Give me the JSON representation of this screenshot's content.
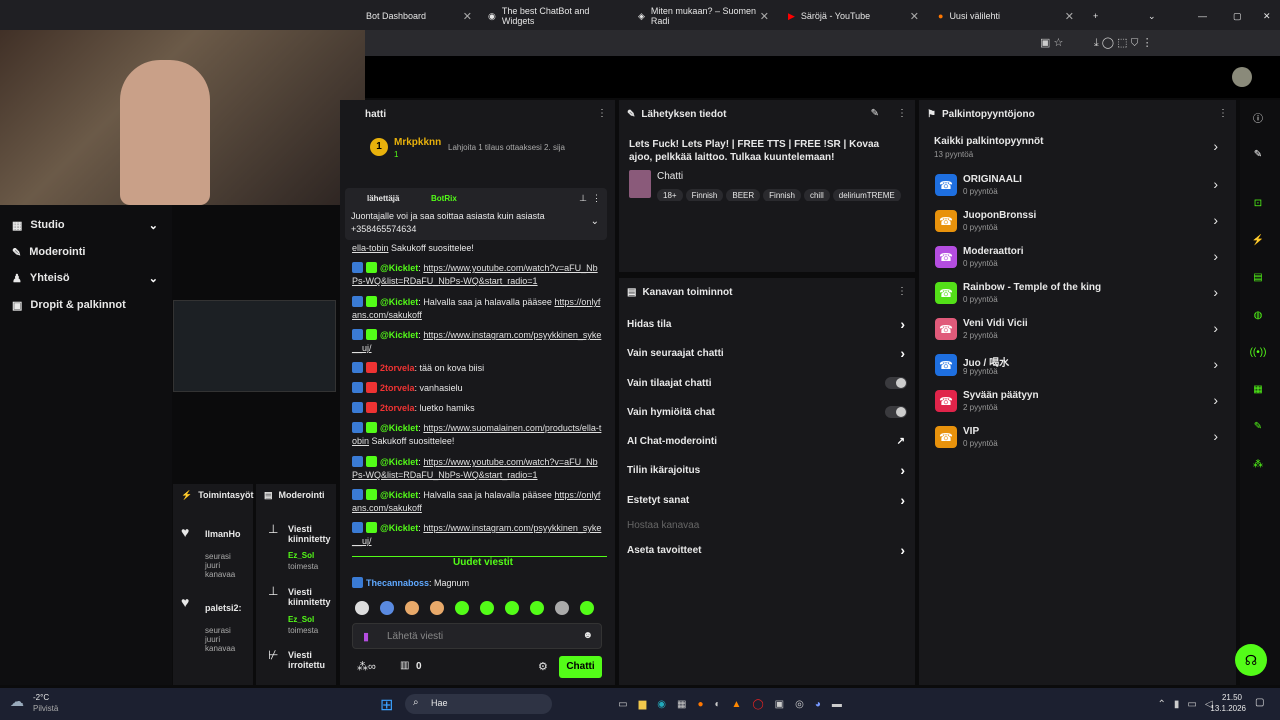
{
  "tabs": [
    {
      "label": "Bot Dashboard"
    },
    {
      "label": "The best ChatBot and Widgets"
    },
    {
      "label": "Miten mukaan? – Suomen Radi"
    },
    {
      "label": "Säröjä - YouTube"
    },
    {
      "label": "Uusi välilehti"
    }
  ],
  "sidebar": {
    "items": [
      {
        "label": "Studio"
      },
      {
        "label": "Moderointi"
      },
      {
        "label": "Yhteisö"
      },
      {
        "label": "Dropit & palkinnot"
      }
    ]
  },
  "chat": {
    "title": "hatti",
    "top_user": "Mrkpkknn",
    "top_badge": "1",
    "gift_text": "Lahjoita 1 tilaus ottaaksesi 2. sija",
    "pinned_by": "lähettäjä",
    "pinned_user": "BotRix",
    "pinned_text": "Juontajalle voi ja saa soittaa asiasta kuin asiasta +358465574634",
    "messages": [
      {
        "user": "",
        "text": "ella-tobin",
        "link": "",
        "tail": " Sakukoff suosittelee!",
        "color": "#53fc18"
      },
      {
        "user": "@Kicklet",
        "link": "https://www.youtube.com/watch?v=aFU_NbPs-WQ&list=RDaFU_NbPs-WQ&start_radio=1",
        "text": "",
        "tail": "",
        "color": "#53fc18"
      },
      {
        "user": "@Kicklet",
        "text": "Halvalla saa ja halavalla pääsee ",
        "link": "https://onlyfans.com/sakukoff",
        "tail": "",
        "color": "#53fc18"
      },
      {
        "user": "@Kicklet",
        "link": "https://www.instagram.com/psyykkinen_syke__uj/",
        "text": "",
        "tail": "",
        "color": "#53fc18"
      },
      {
        "user": "2torvela",
        "text": "tää on kova biisi",
        "link": "",
        "tail": "",
        "color": "#e33"
      },
      {
        "user": "2torvela",
        "text": "vanhasielu",
        "link": "",
        "tail": "",
        "color": "#e33"
      },
      {
        "user": "2torvela",
        "text": "luetko hamiks",
        "link": "",
        "tail": "",
        "color": "#e33"
      },
      {
        "user": "@Kicklet",
        "link": "https://www.suomalainen.com/products/ella-tobin",
        "text": "",
        "tail": " Sakukoff suosittelee!",
        "color": "#53fc18"
      },
      {
        "user": "@Kicklet",
        "link": "https://www.youtube.com/watch?v=aFU_NbPs-WQ&list=RDaFU_NbPs-WQ&start_radio=1",
        "text": "",
        "tail": "",
        "color": "#53fc18"
      },
      {
        "user": "@Kicklet",
        "text": "Halvalla saa ja halavalla pääsee ",
        "link": "https://onlyfans.com/sakukoff",
        "tail": "",
        "color": "#53fc18"
      },
      {
        "user": "@Kicklet",
        "link": "https://www.instagram.com/psyykkinen_syke__uj/",
        "text": "",
        "tail": "",
        "color": "#53fc18"
      }
    ],
    "new_messages": "Uudet viestit",
    "last_user": "Thecannaboss",
    "last_text": "Magnum",
    "input_placeholder": "Lähetä viesti",
    "points": "0",
    "send_label": "Chatti"
  },
  "stream_info": {
    "title": "Lähetyksen tiedot",
    "stream_title": "Lets Fuck! Lets Play! | FREE TTS | FREE !SR | Kovaa ajoo, pelkkää laittoo. Tulkaa kuuntelemaan!",
    "category": "Chatti",
    "tags": [
      "18+",
      "Finnish",
      "BEER",
      "Finnish",
      "chill",
      "deliriumTREME"
    ]
  },
  "channel_actions": {
    "title": "Kanavan toiminnot",
    "items": [
      {
        "label": "Hidas tila",
        "kind": "chev"
      },
      {
        "label": "Vain seuraajat chatti",
        "kind": "chev"
      },
      {
        "label": "Vain tilaajat chatti",
        "kind": "toggle"
      },
      {
        "label": "Vain hymiöitä chat",
        "kind": "toggle"
      },
      {
        "label": "AI Chat-moderointi",
        "kind": "ext"
      },
      {
        "label": "Tilin ikärajoitus",
        "kind": "chev"
      },
      {
        "label": "Estetyt sanat",
        "kind": "chev"
      },
      {
        "label": "Hostaa kanavaa",
        "kind": "dim"
      },
      {
        "label": "Aseta tavoitteet",
        "kind": "chev"
      }
    ]
  },
  "rewards": {
    "title": "Palkintopyyntöjono",
    "all_label": "Kaikki palkintopyynnöt",
    "all_count": "13 pyyntöä",
    "items": [
      {
        "name": "ORIGINAALI",
        "count": "0 pyyntöä",
        "color": "#1e6fe0"
      },
      {
        "name": "JuoponBronssi",
        "count": "0 pyyntöä",
        "color": "#e8920c"
      },
      {
        "name": "Moderaattori",
        "count": "0 pyyntöä",
        "color": "#b44de0"
      },
      {
        "name": "Rainbow - Temple of the king",
        "count": "0 pyyntöä",
        "color": "#53e018"
      },
      {
        "name": "Veni Vidi Vicii",
        "count": "2 pyyntöä",
        "color": "#e05a7a"
      },
      {
        "name": "Juo / 喝水",
        "count": "9 pyyntöä",
        "color": "#1e6fe0"
      },
      {
        "name": "Syvään päätyyn",
        "count": "2 pyyntöä",
        "color": "#e0244a"
      },
      {
        "name": "VIP",
        "count": "0 pyyntöä",
        "color": "#e8920c"
      }
    ]
  },
  "bottom": {
    "tab1": "Toimintasyöt",
    "tab2": "Moderointi",
    "feed": [
      {
        "name": "IlmanHo",
        "sub": "seurasi juuri kanavaa"
      },
      {
        "name": "paletsi2:",
        "sub": "seurasi juuri kanavaa"
      }
    ],
    "mod": [
      {
        "title": "Viesti kiinnitetty",
        "who": "Ez_Sol",
        "tail": "toimesta"
      },
      {
        "title": "Viesti kiinnitetty",
        "who": "Ez_Sol",
        "tail": "toimesta"
      },
      {
        "title": "Viesti irroitettu",
        "who": "",
        "tail": ""
      }
    ]
  },
  "taskbar": {
    "weather_temp": "-2°C",
    "weather_text": "Pilvistä",
    "search": "Hae",
    "time": "21.50",
    "date": "13.1.2026"
  }
}
